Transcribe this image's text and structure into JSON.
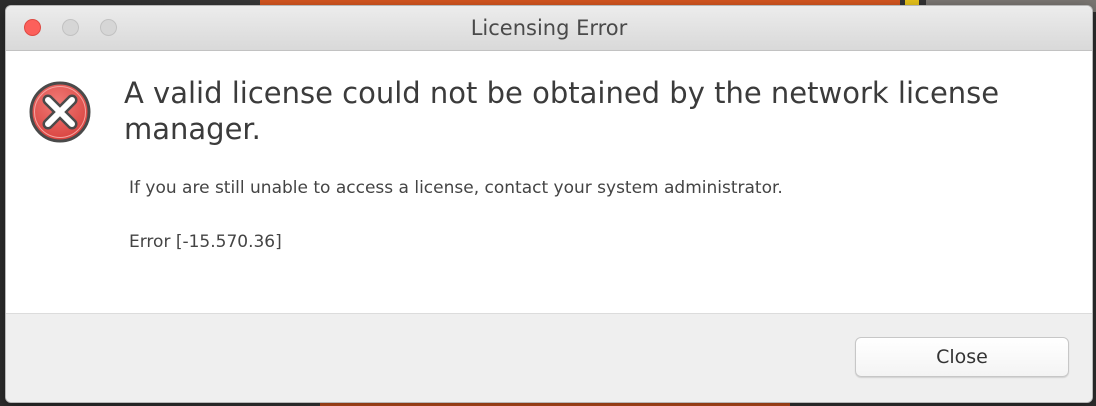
{
  "window": {
    "title": "Licensing Error"
  },
  "dialog": {
    "icon": "error-x-icon",
    "headline": "A valid license could not be obtained by the network license manager.",
    "message": "If you are still unable to access a license, contact your system administrator.",
    "error_code": "Error [-15.570.36]"
  },
  "buttons": {
    "close_label": "Close"
  },
  "colors": {
    "error_red": "#e0504e",
    "close_traffic": "#fc605b"
  }
}
